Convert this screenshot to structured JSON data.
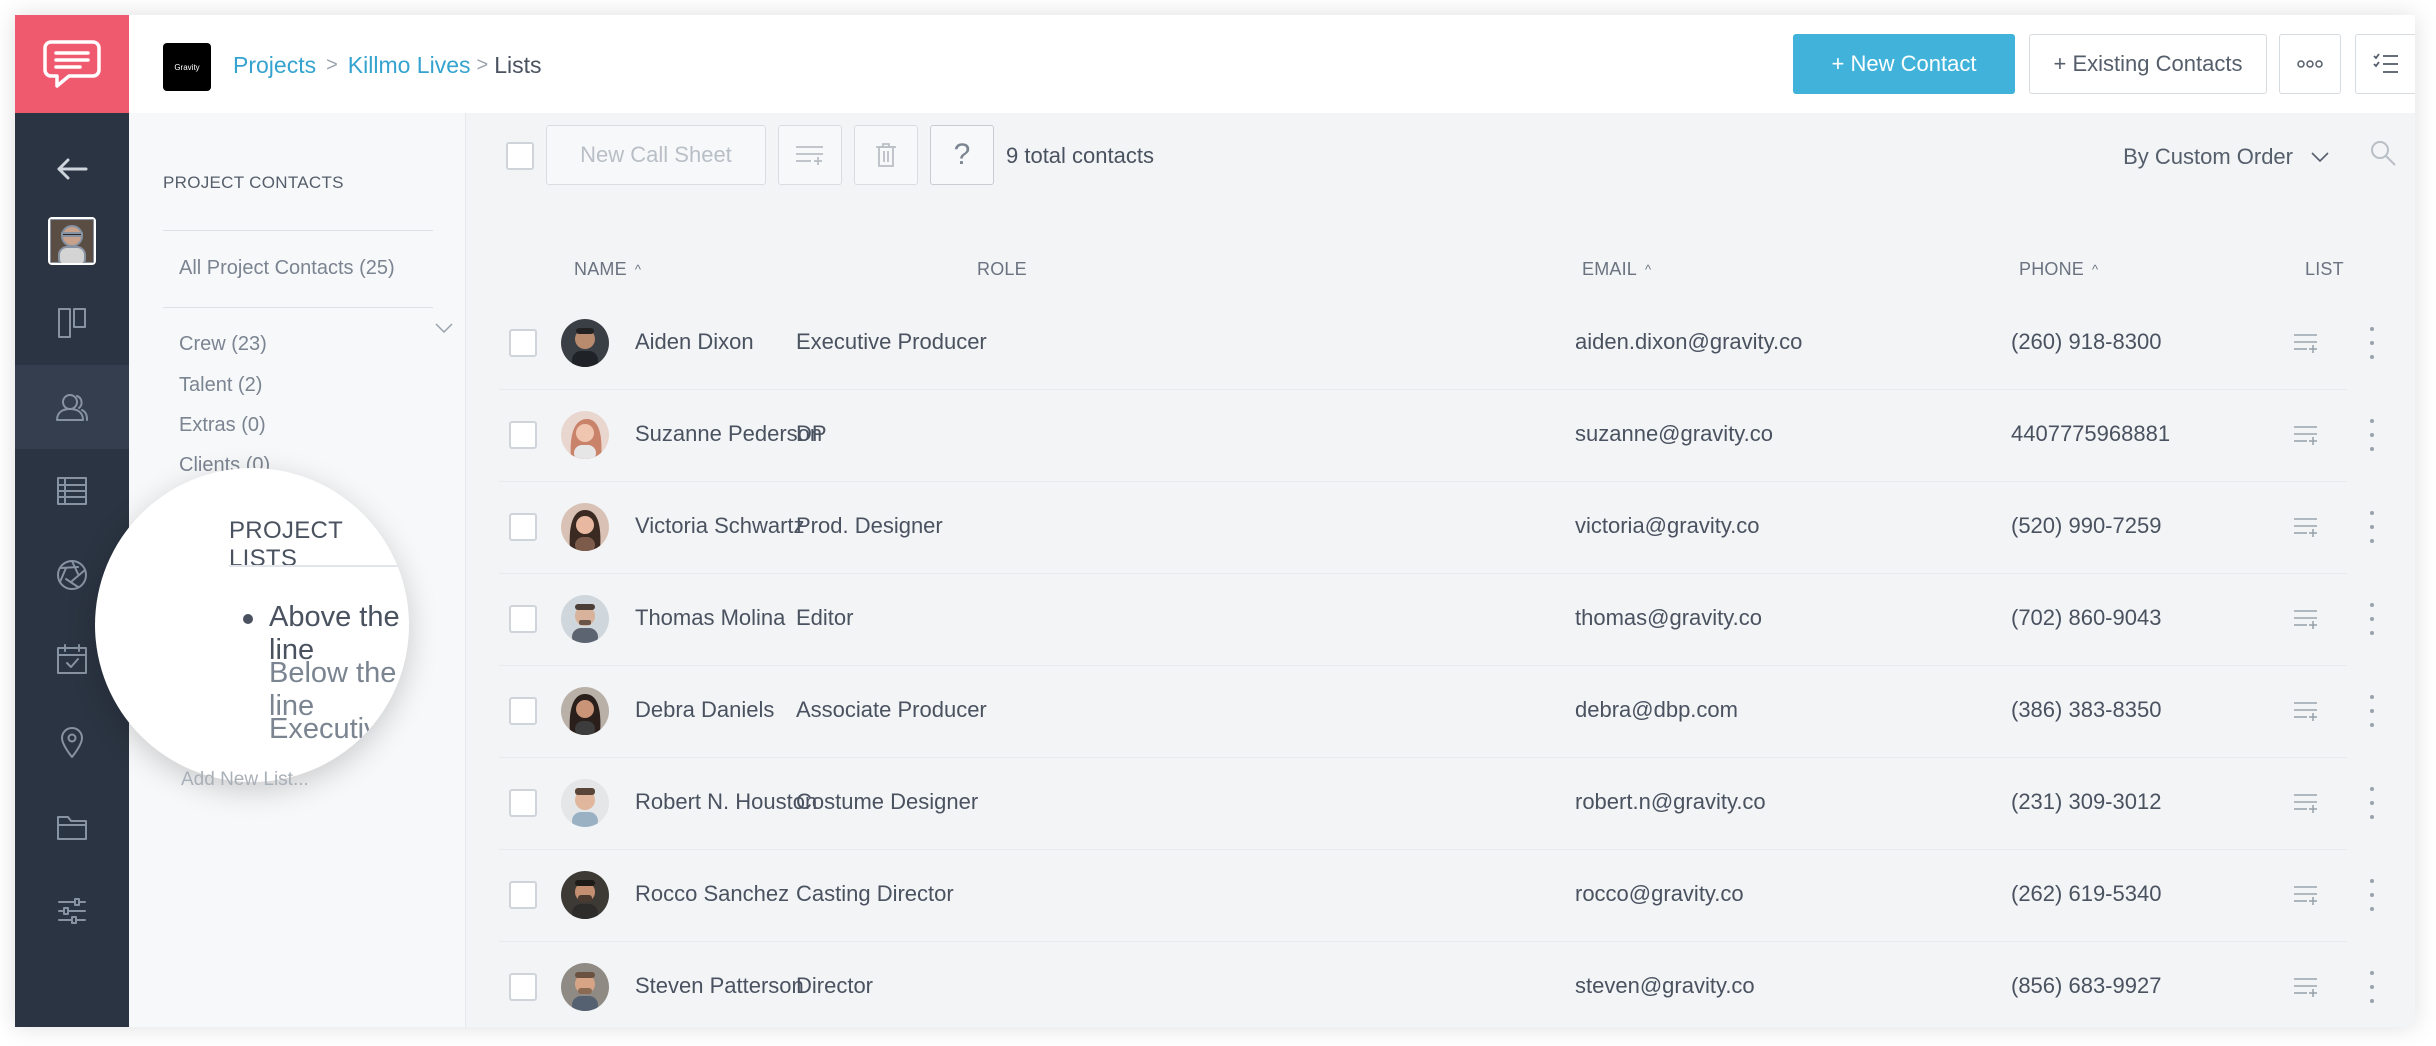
{
  "header": {
    "brand_logo_text": "Gravity",
    "breadcrumb": [
      "Projects",
      "Killmo Lives",
      "Lists"
    ],
    "new_contact_label": "+ New Contact",
    "existing_contacts_label": "+ Existing Contacts",
    "accent_color": "#41b3da"
  },
  "rail": {
    "logo_color": "#f05a6f",
    "items": [
      "back-arrow-icon",
      "user-avatar",
      "board-icon",
      "contacts-icon",
      "table-icon",
      "aperture-icon",
      "calendar-icon",
      "location-pin-icon",
      "folder-icon",
      "sliders-icon"
    ],
    "active": "contacts-icon"
  },
  "sidebar": {
    "contacts_heading": "PROJECT CONTACTS",
    "all_contacts": "All Project Contacts (25)",
    "categories": [
      "Crew (23)",
      "Talent (2)",
      "Extras (0)",
      "Clients (0)"
    ],
    "lists_heading": "PROJECT LISTS",
    "lists": [
      "Above the line",
      "Below the line",
      "Executives"
    ],
    "active_list": "Above the line",
    "add_list": "Add New List..."
  },
  "toolbar": {
    "call_sheet_label": "New Call Sheet",
    "help_label": "?",
    "total_contacts": "9 total contacts",
    "sort_order": "By Custom Order"
  },
  "table": {
    "columns": {
      "name": "NAME",
      "role": "ROLE",
      "email": "EMAIL",
      "phone": "PHONE",
      "list": "LIST"
    },
    "rows": [
      {
        "name": "Aiden Dixon",
        "role": "Executive Producer",
        "email": "aiden.dixon@gravity.co",
        "phone": "(260) 918-8300"
      },
      {
        "name": "Suzanne Pederson",
        "role": "DP",
        "email": "suzanne@gravity.co",
        "phone": "4407775968881"
      },
      {
        "name": "Victoria Schwartz",
        "role": "Prod. Designer",
        "email": "victoria@gravity.co",
        "phone": "(520) 990-7259"
      },
      {
        "name": "Thomas Molina",
        "role": "Editor",
        "email": "thomas@gravity.co",
        "phone": "(702) 860-9043"
      },
      {
        "name": "Debra Daniels",
        "role": "Associate Producer",
        "email": "debra@dbp.com",
        "phone": "(386) 383-8350"
      },
      {
        "name": "Robert N. Houston",
        "role": "Costume Designer",
        "email": "robert.n@gravity.co",
        "phone": "(231) 309-3012"
      },
      {
        "name": "Rocco Sanchez",
        "role": "Casting Director",
        "email": "rocco@gravity.co",
        "phone": "(262) 619-5340"
      },
      {
        "name": "Steven Patterson",
        "role": "Director",
        "email": "steven@gravity.co",
        "phone": "(856) 683-9927"
      }
    ]
  }
}
